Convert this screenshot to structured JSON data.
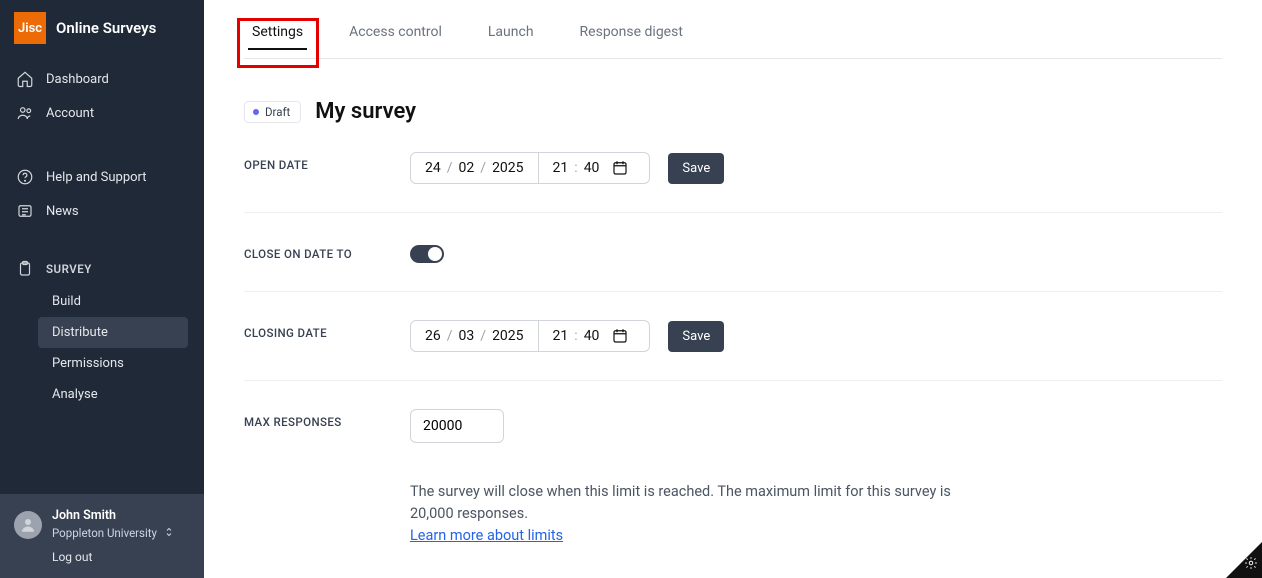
{
  "brand": {
    "logo_text": "Jisc",
    "title": "Online Surveys"
  },
  "nav": {
    "dashboard": "Dashboard",
    "account": "Account",
    "help": "Help and Support",
    "news": "News",
    "section": "SURVEY",
    "build": "Build",
    "distribute": "Distribute",
    "permissions": "Permissions",
    "analyse": "Analyse"
  },
  "user": {
    "name": "John Smith",
    "org": "Poppleton University",
    "logout": "Log out"
  },
  "tabs": {
    "settings": "Settings",
    "access": "Access control",
    "launch": "Launch",
    "digest": "Response digest"
  },
  "survey": {
    "status": "Draft",
    "title": "My survey"
  },
  "open_date": {
    "label": "OPEN DATE",
    "day": "24",
    "month": "02",
    "year": "2025",
    "hour": "21",
    "minute": "40",
    "save": "Save"
  },
  "close_toggle": {
    "label": "CLOSE ON DATE TO"
  },
  "closing_date": {
    "label": "CLOSING DATE",
    "day": "26",
    "month": "03",
    "year": "2025",
    "hour": "21",
    "minute": "40",
    "save": "Save"
  },
  "max_responses": {
    "label": "MAX RESPONSES",
    "value": "20000",
    "help": "The survey will close when this limit is reached. The maximum limit for this survey is 20,000 responses.",
    "link": "Learn more about limits"
  }
}
